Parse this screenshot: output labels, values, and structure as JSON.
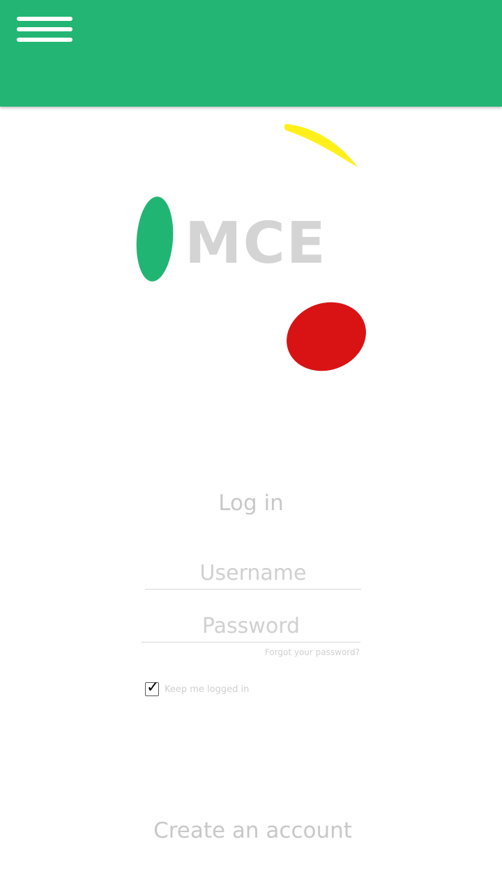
{
  "colors": {
    "appbar": "#22b573",
    "logo_green": "#21b573",
    "logo_yellow": "#fff01c",
    "logo_red": "#d91314",
    "logo_text": "#d4d4d4"
  },
  "appbar": {
    "menu_icon": "hamburger-menu-icon"
  },
  "logo": {
    "text": "MCE"
  },
  "login": {
    "title": "Log in",
    "username_placeholder": "Username",
    "username_value": "",
    "password_placeholder": "Password",
    "password_value": "",
    "forgot_link": "Forgot your password?",
    "keep_logged_in_label": "Keep me logged in",
    "keep_logged_in_checked": true,
    "create_account": "Create an account"
  }
}
